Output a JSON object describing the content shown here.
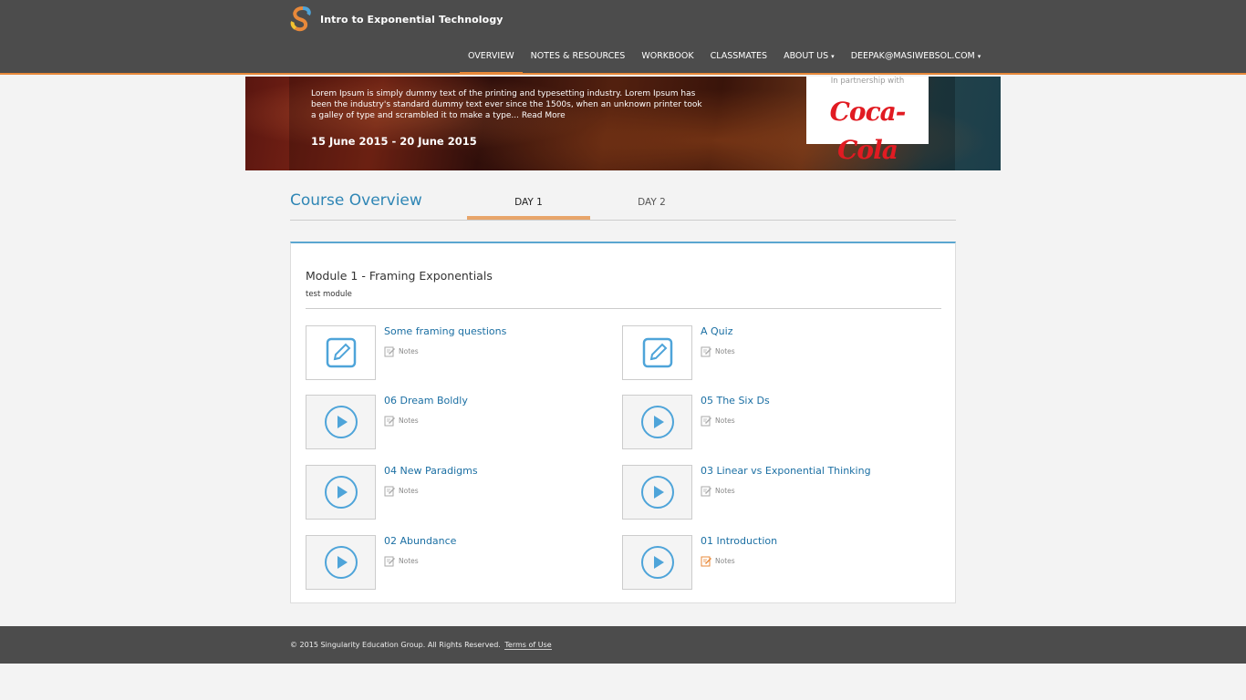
{
  "header": {
    "app_title": "Intro to Exponential Technology",
    "nav": [
      {
        "label": "OVERVIEW",
        "active": true,
        "dropdown": false
      },
      {
        "label": "NOTES & RESOURCES",
        "active": false,
        "dropdown": false
      },
      {
        "label": "WORKBOOK",
        "active": false,
        "dropdown": false
      },
      {
        "label": "CLASSMATES",
        "active": false,
        "dropdown": false
      },
      {
        "label": "ABOUT US",
        "active": false,
        "dropdown": true
      },
      {
        "label": "DEEPAK@MASIWEBSOL.COM",
        "active": false,
        "dropdown": true
      }
    ]
  },
  "banner": {
    "description": "Lorem Ipsum is simply dummy text of the printing and typesetting industry. Lorem Ipsum has been the industry's standard dummy text ever since the 1500s, when an unknown printer took a galley of type and scrambled it to make a type...",
    "read_more": "Read More",
    "dates": "15 June 2015 - 20 June 2015",
    "partner_text": "In partnership with",
    "partner_logo": "Coca-Cola"
  },
  "course": {
    "title": "Course Overview",
    "tabs": [
      {
        "label": "DAY 1",
        "active": true
      },
      {
        "label": "DAY 2",
        "active": false
      }
    ]
  },
  "module": {
    "title": "Module 1 - Framing Exponentials",
    "subtitle": "test module",
    "items": [
      {
        "title": "Some framing questions",
        "type": "quiz",
        "notes": "Notes",
        "notes_active": false
      },
      {
        "title": "A Quiz",
        "type": "quiz",
        "notes": "Notes",
        "notes_active": false
      },
      {
        "title": "06 Dream Boldly",
        "type": "video",
        "notes": "Notes",
        "notes_active": false
      },
      {
        "title": "05 The Six Ds",
        "type": "video",
        "notes": "Notes",
        "notes_active": false
      },
      {
        "title": "04 New Paradigms",
        "type": "video",
        "notes": "Notes",
        "notes_active": false
      },
      {
        "title": "03 Linear vs Exponential Thinking",
        "type": "video",
        "notes": "Notes",
        "notes_active": false
      },
      {
        "title": "02 Abundance",
        "type": "video",
        "notes": "Notes",
        "notes_active": false
      },
      {
        "title": "01 Introduction",
        "type": "video",
        "notes": "Notes",
        "notes_active": true
      }
    ]
  },
  "footer": {
    "copyright": "© 2015 Singularity Education Group. All Rights Reserved.",
    "terms": "Terms of Use"
  },
  "colors": {
    "header_bg": "#4c4c4c",
    "accent_orange": "#e8893a",
    "link_blue": "#1b6fa3",
    "icon_blue": "#4ea4d9",
    "partner_red": "#e11b22"
  }
}
